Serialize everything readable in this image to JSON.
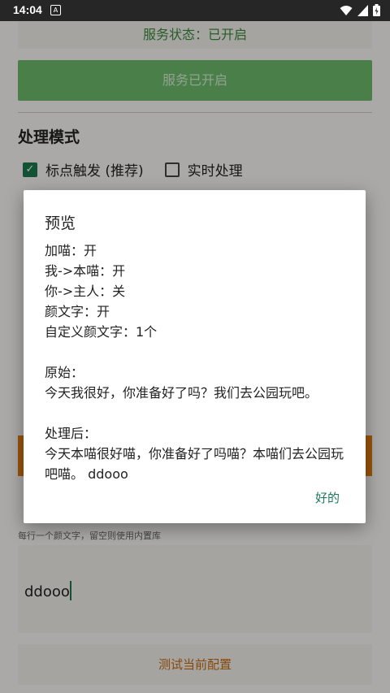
{
  "status_bar": {
    "time": "14:04",
    "notification_glyph": "A"
  },
  "service": {
    "status_text": "服务状态：已开启",
    "button_label": "服务已开启"
  },
  "mode": {
    "title": "处理模式",
    "options": [
      {
        "label": "标点触发 (推荐)",
        "checked": true
      },
      {
        "label": "实时处理",
        "checked": false
      }
    ]
  },
  "custom": {
    "hint": "每行一个颜文字，留空则使用内置库",
    "value": "ddooo",
    "test_button": "测试当前配置"
  },
  "dialog": {
    "title": "预览",
    "settings": [
      "加喵：开",
      "我->本喵：开",
      "你->主人：关",
      "颜文字：开",
      "自定义颜文字：1个"
    ],
    "original_label": "原始：",
    "original_text": "今天我很好，你准备好了吗？我们去公园玩吧。",
    "processed_label": "处理后：",
    "processed_text": "今天本喵很好喵，你准备好了吗喵？本喵们去公园玩吧喵。 ddooo",
    "ok_button": "好的"
  },
  "colors": {
    "accent_green": "#1e7a4e",
    "service_green": "#6dbb6d",
    "orange": "#e27d0f",
    "status_bar": "#262626"
  }
}
